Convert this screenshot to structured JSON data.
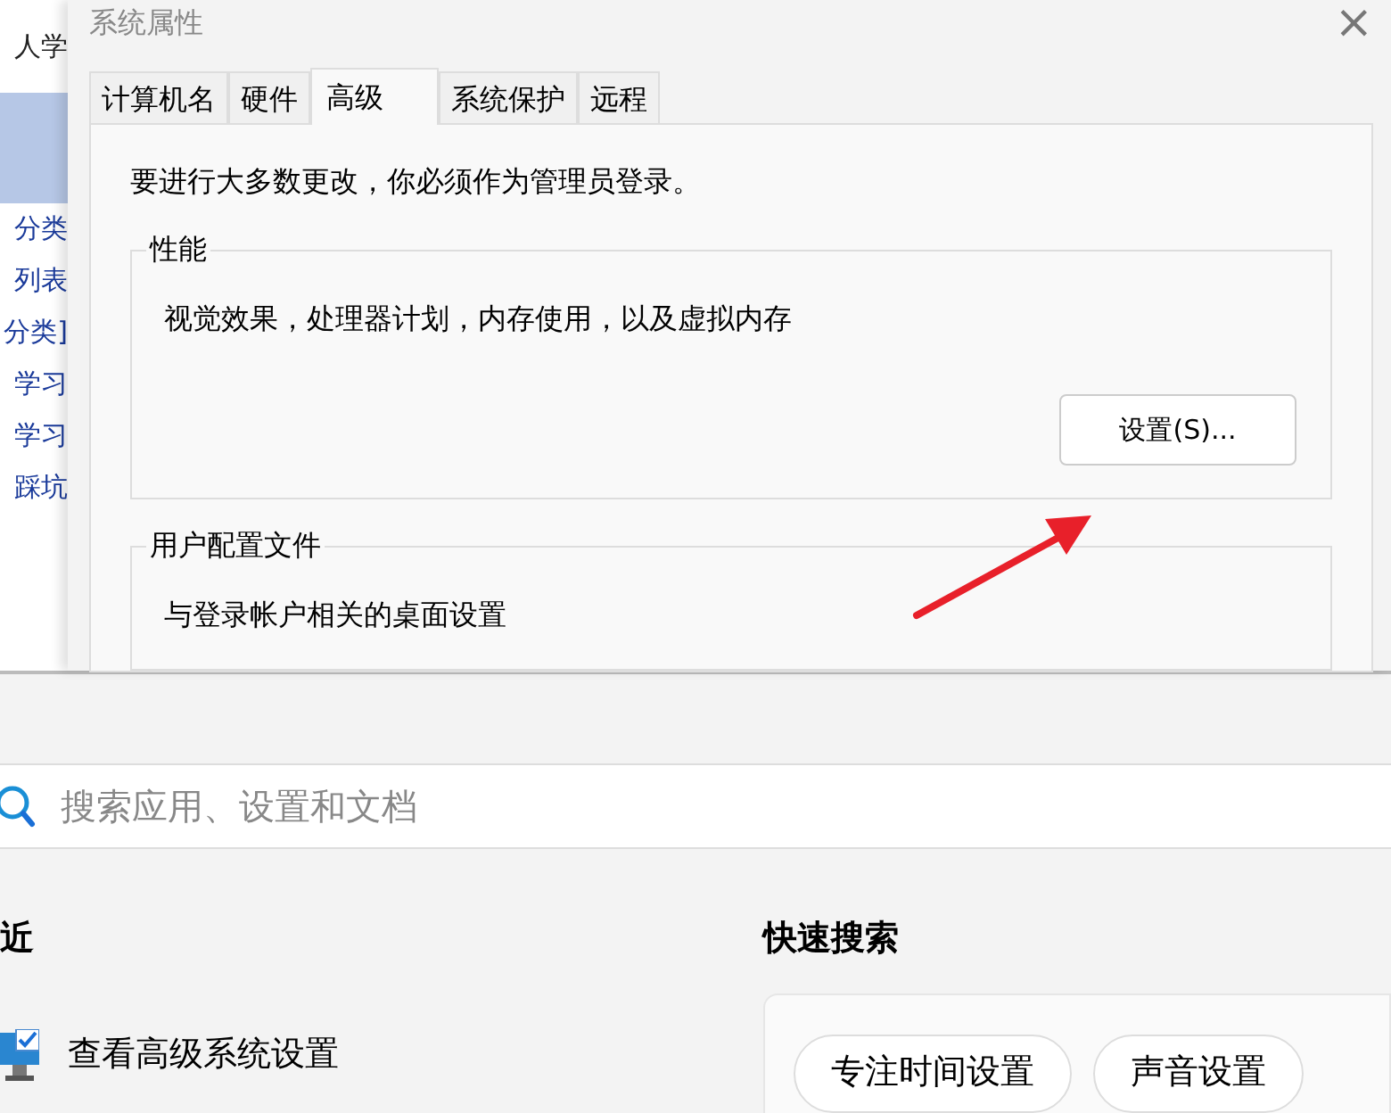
{
  "background_sidebar": {
    "items": [
      {
        "label": "人学",
        "selected": false
      },
      {
        "selected": true
      },
      {
        "label": "分类",
        "selected": false
      },
      {
        "label": "列表",
        "selected": false
      },
      {
        "label": "分类]",
        "selected": false
      },
      {
        "label": "学习",
        "selected": false
      },
      {
        "label": "学习",
        "selected": false
      },
      {
        "label": "踩坑",
        "selected": false
      }
    ]
  },
  "dialog": {
    "title": "系统属性",
    "close": "×",
    "tabs": [
      {
        "label": "计算机名",
        "selected": false
      },
      {
        "label": "硬件",
        "selected": false
      },
      {
        "label": "高级",
        "selected": true
      },
      {
        "label": "系统保护",
        "selected": false
      },
      {
        "label": "远程",
        "selected": false
      }
    ],
    "notice": "要进行大多数更改，你必须作为管理员登录。",
    "groups": [
      {
        "title": "性能",
        "description": "视觉效果，处理器计划，内存使用，以及虚拟内存",
        "button": "设置(S)..."
      },
      {
        "title": "用户配置文件",
        "description": "与登录帐户相关的桌面设置"
      }
    ]
  },
  "start_search": {
    "placeholder": "搜索应用、设置和文档",
    "recent_heading": "近",
    "recent_items": [
      {
        "label": "查看高级系统设置"
      }
    ],
    "quick_heading": "快速搜索",
    "quick_chips": [
      "专注时间设置",
      "声音设置"
    ]
  }
}
